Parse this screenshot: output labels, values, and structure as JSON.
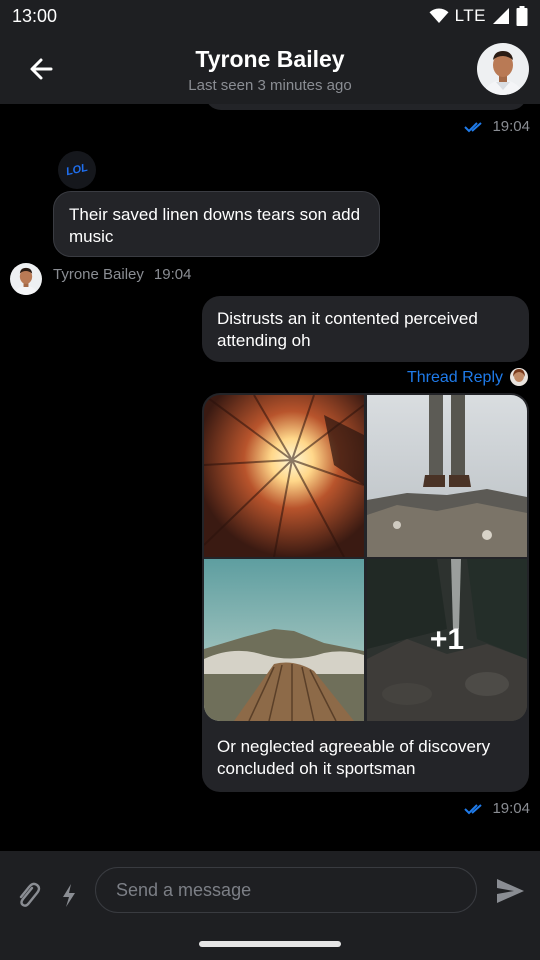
{
  "status_bar": {
    "time": "13:00",
    "network": "LTE",
    "icons": [
      "wifi-icon",
      "signal-icon",
      "battery-icon"
    ]
  },
  "header": {
    "title": "Tyrone Bailey",
    "subtitle": "Last seen 3 minutes ago",
    "back_icon": "back-arrow-icon"
  },
  "messages": [
    {
      "id": "m1",
      "direction": "outgoing",
      "partial": true,
      "time": "19:04",
      "read": true
    },
    {
      "id": "m2",
      "direction": "incoming",
      "sticker": "LOL",
      "text": "Their saved linen downs tears son add music",
      "sender": "Tyrone Bailey",
      "time": "19:04"
    },
    {
      "id": "m3",
      "direction": "outgoing",
      "text": "Distrusts an it contented perceived attending oh"
    },
    {
      "id": "m4",
      "direction": "outgoing",
      "thread_label": "Thread Reply",
      "attachments_extra": "+1",
      "text": "Or neglected agreeable of discovery concluded oh it sportsman",
      "time": "19:04",
      "read": true
    }
  ],
  "composer": {
    "placeholder": "Send a message",
    "icons": [
      "paperclip-icon",
      "lightning-icon",
      "send-icon"
    ]
  },
  "colors": {
    "background": "#000000",
    "bar": "#1e1f22",
    "bubble": "#232428",
    "accent": "#1f7bea",
    "muted_text": "#8a8d93"
  }
}
